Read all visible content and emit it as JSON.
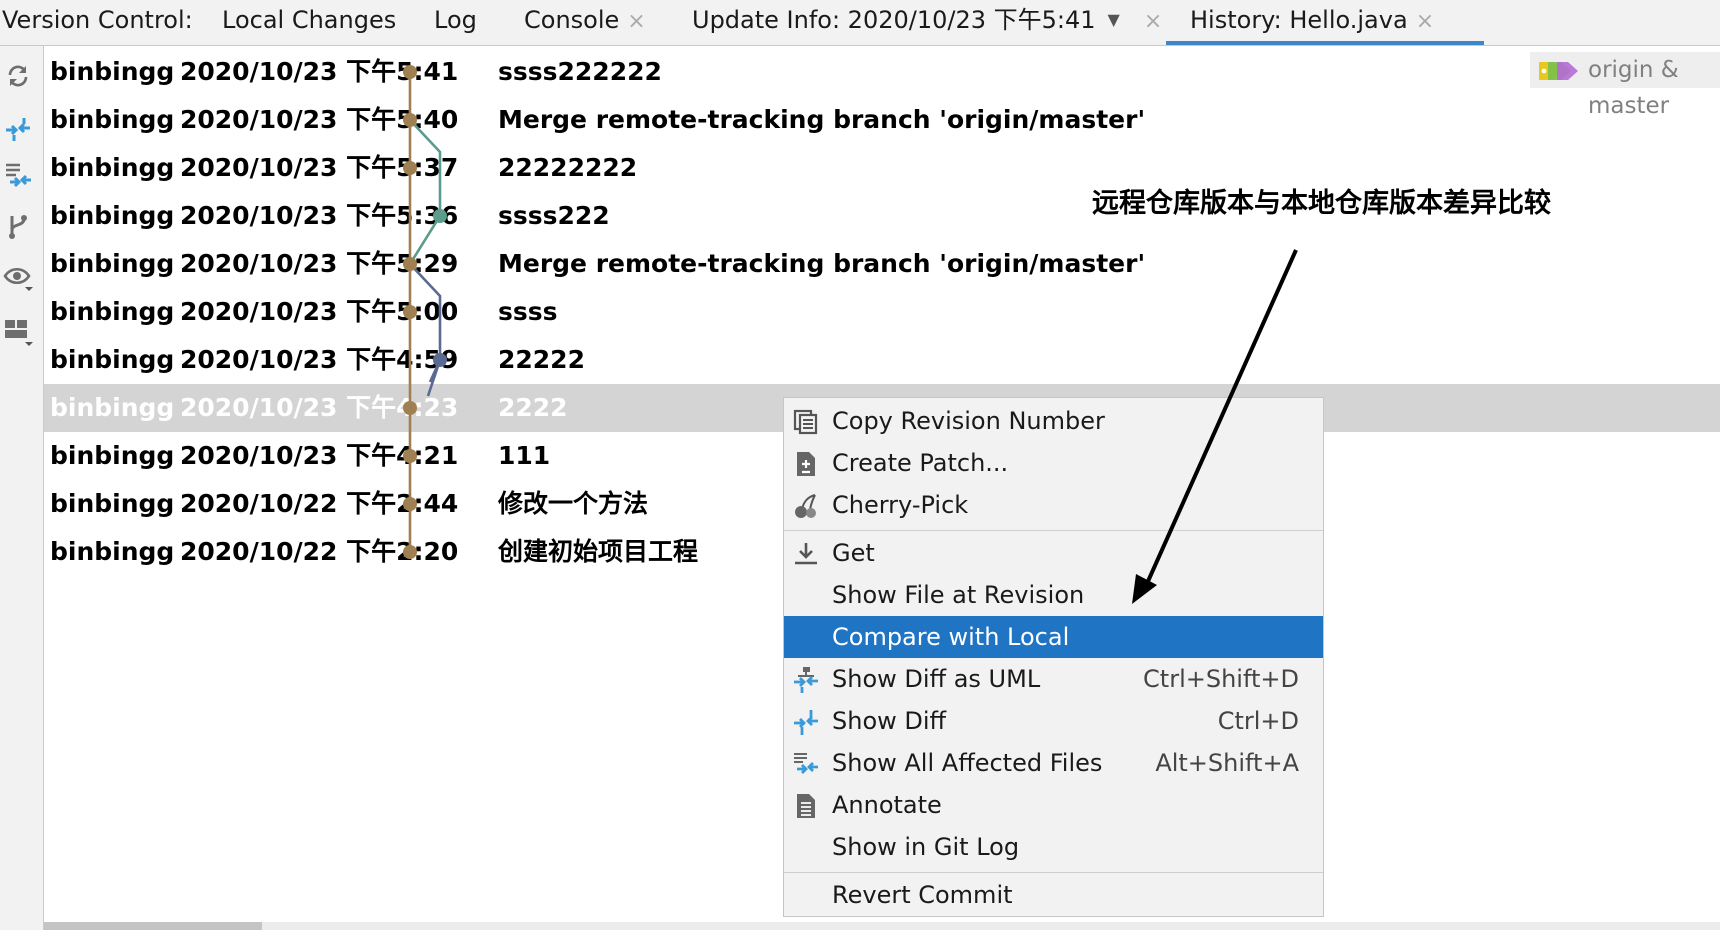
{
  "tabbar": {
    "label": "Version Control:",
    "tabs": [
      {
        "label": "Local Changes"
      },
      {
        "label": "Log"
      },
      {
        "label": "Console",
        "close": "×"
      },
      {
        "label": "Update Info: 2020/10/23 下午5:41",
        "close": "×"
      },
      {
        "label": "History: Hello.java",
        "close": "×"
      }
    ]
  },
  "toolbar": {
    "icons": [
      "refresh-icon",
      "show-diff-icon",
      "show-affected-files-icon",
      "branch-icon",
      "eye-icon",
      "layout-icon"
    ]
  },
  "branch_badge": {
    "text": "origin & master"
  },
  "commits": [
    {
      "author": "binbingg",
      "date": "2020/10/23 下午5:41",
      "message": "ssss222222"
    },
    {
      "author": "binbingg",
      "date": "2020/10/23 下午5:40",
      "message": "Merge remote-tracking branch 'origin/master'"
    },
    {
      "author": "binbingg",
      "date": "2020/10/23 下午5:37",
      "message": "22222222"
    },
    {
      "author": "binbingg",
      "date": "2020/10/23 下午5:36",
      "message": "ssss222"
    },
    {
      "author": "binbingg",
      "date": "2020/10/23 下午5:29",
      "message": "Merge remote-tracking branch 'origin/master'"
    },
    {
      "author": "binbingg",
      "date": "2020/10/23 下午5:00",
      "message": "ssss"
    },
    {
      "author": "binbingg",
      "date": "2020/10/23 下午4:59",
      "message": "22222"
    },
    {
      "author": "binbingg",
      "date": "2020/10/23 下午4:23",
      "message": "2222",
      "selected": true
    },
    {
      "author": "binbingg",
      "date": "2020/10/23 下午4:21",
      "message": "111"
    },
    {
      "author": "binbingg",
      "date": "2020/10/22 下午2:44",
      "message": "修改一个方法"
    },
    {
      "author": "binbingg",
      "date": "2020/10/22 下午2:20",
      "message": "创建初始项目工程"
    }
  ],
  "annotation": {
    "text": "远程仓库版本与本地仓库版本差异比较"
  },
  "context_menu": {
    "items": [
      {
        "label": "Copy Revision Number",
        "icon": "copy-icon"
      },
      {
        "label": "Create Patch...",
        "icon": "patch-icon"
      },
      {
        "label": "Cherry-Pick",
        "icon": "cherry-icon"
      },
      {
        "label": "Get",
        "icon": "download-icon"
      },
      {
        "label": "Show File at Revision",
        "icon": ""
      },
      {
        "label": "Compare with Local",
        "icon": "",
        "highlighted": true
      },
      {
        "label": "Show Diff as UML",
        "icon": "uml-diff-icon",
        "shortcut": "Ctrl+Shift+D"
      },
      {
        "label": "Show Diff",
        "icon": "diff-icon",
        "shortcut": "Ctrl+D"
      },
      {
        "label": "Show All Affected Files",
        "icon": "affected-files-icon",
        "shortcut": "Alt+Shift+A"
      },
      {
        "label": "Annotate",
        "icon": "annotate-icon"
      },
      {
        "label": "Show in Git Log",
        "icon": ""
      },
      {
        "label": "Revert Commit",
        "icon": ""
      }
    ]
  },
  "colors": {
    "accent": "#1f74c4",
    "graph_main": "#a08050",
    "graph_teal": "#5b9c8c",
    "graph_slate": "#5a6a90"
  }
}
